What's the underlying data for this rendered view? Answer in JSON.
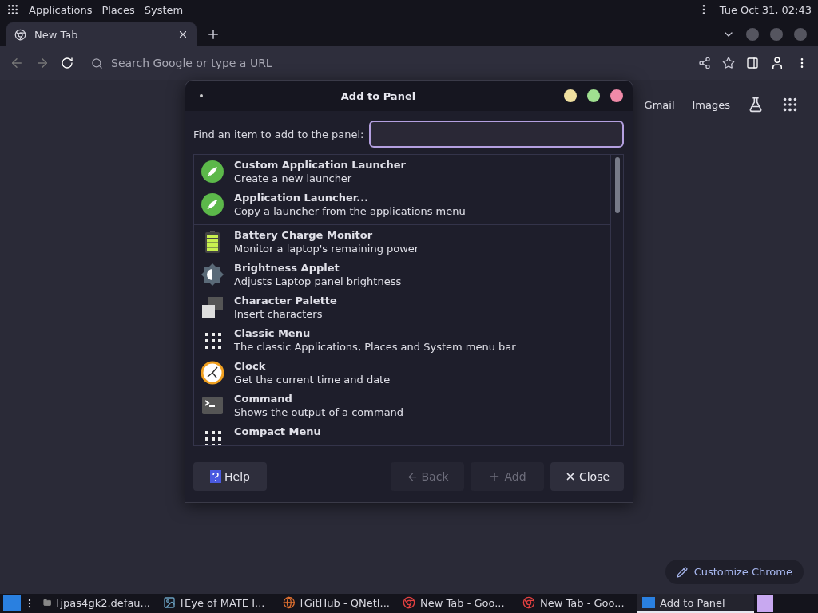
{
  "top_panel": {
    "menus": [
      "Applications",
      "Places",
      "System"
    ],
    "clock": "Tue Oct 31, 02:43"
  },
  "browser": {
    "tabs": [
      {
        "label": "New Tab",
        "selected": true
      }
    ],
    "address": {
      "placeholder": "Search Google or type a URL"
    },
    "links": [
      "Gmail",
      "Images"
    ],
    "customize": "Customize Chrome"
  },
  "dialog": {
    "title": "Add to Panel",
    "search_label": "Find an item to add to the panel:",
    "groups": [
      {
        "items": [
          {
            "kind": "launcher",
            "name": "Custom Application Launcher",
            "description": "Create a new launcher"
          },
          {
            "kind": "launcher",
            "name": "Application Launcher...",
            "description": "Copy a launcher from the applications menu"
          }
        ]
      },
      {
        "items": [
          {
            "kind": "battery",
            "name": "Battery Charge Monitor",
            "description": "Monitor a laptop's remaining power"
          },
          {
            "kind": "brightness",
            "name": "Brightness Applet",
            "description": "Adjusts Laptop panel brightness"
          },
          {
            "kind": "charpalette",
            "name": "Character Palette",
            "description": "Insert characters"
          },
          {
            "kind": "menu",
            "name": "Classic Menu",
            "description": "The classic Applications, Places and System menu bar"
          },
          {
            "kind": "clock",
            "name": "Clock",
            "description": "Get the current time and date"
          },
          {
            "kind": "command",
            "name": "Command",
            "description": "Shows the output of a command"
          },
          {
            "kind": "menu",
            "name": "Compact Menu"
          }
        ]
      }
    ],
    "buttons": [
      {
        "kind": "help",
        "label": "Help",
        "disabled": false
      },
      {
        "kind": "back",
        "label": "Back",
        "disabled": true
      },
      {
        "kind": "add",
        "label": "Add",
        "disabled": true
      },
      {
        "kind": "close",
        "label": "Close",
        "disabled": false
      }
    ]
  },
  "taskbar": {
    "items": [
      {
        "kind": "folder",
        "label": "[jpas4gk2.defau...",
        "selected": false
      },
      {
        "kind": "image",
        "label": "[Eye of MATE I...",
        "selected": false
      },
      {
        "kind": "firefox",
        "label": "[GitHub - QNetI...",
        "selected": false
      },
      {
        "kind": "chrome",
        "label": "New Tab - Goo...",
        "selected": false
      },
      {
        "kind": "chrome",
        "label": "New Tab - Goo...",
        "selected": false
      },
      {
        "kind": "window",
        "label": "Add to Panel",
        "selected": true
      }
    ]
  }
}
